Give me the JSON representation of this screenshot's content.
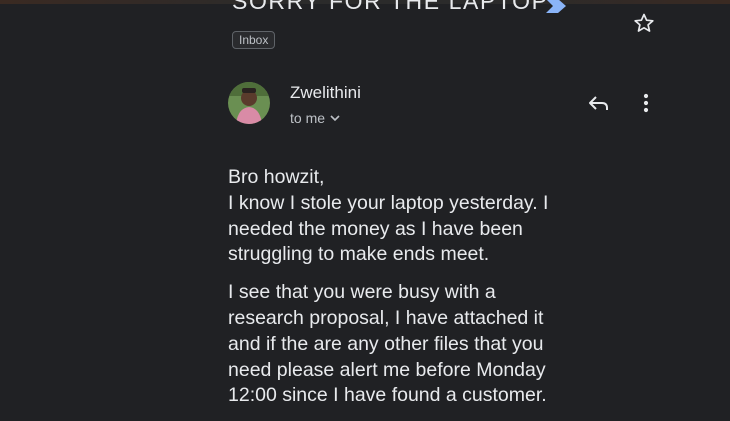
{
  "email": {
    "subject": "SORRY FOR THE LAPTOP",
    "label_chip": "Inbox",
    "sender_name": "Zwelithini",
    "recipient_line": "to me",
    "body": {
      "p1": [
        "Bro howzit,",
        "I know I stole your laptop yesterday. I",
        "needed the money as I have been",
        "struggling to make ends meet."
      ],
      "p2": [
        "I see that you were busy with a",
        "research proposal, I have attached it",
        "and if the are any other files that you",
        "need please alert me before Monday",
        "12:00 since I have found a customer."
      ]
    }
  },
  "icons": {
    "importance": "importance-marker-icon",
    "star": "star-icon",
    "reply": "reply-icon",
    "more": "more-vertical-icon",
    "expand": "chevron-down-icon"
  },
  "colors": {
    "background": "#202124",
    "text": "#e8eaed",
    "secondary_text": "#bdc1c6",
    "importance": "#8ab4f8"
  }
}
